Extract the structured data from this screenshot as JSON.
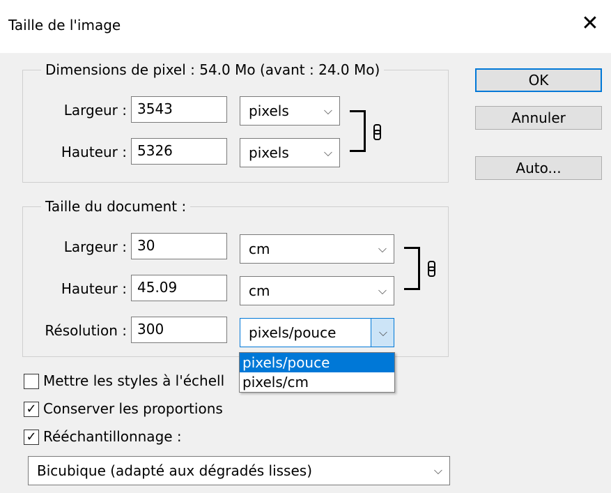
{
  "window": {
    "title": "Taille de l'image",
    "close_glyph": "✕"
  },
  "pixel_dimensions": {
    "legend": "Dimensions de pixel :  54.0 Mo (avant : 24.0 Mo)",
    "width_label": "Largeur :",
    "width_value": "3543",
    "width_unit": "pixels",
    "height_label": "Hauteur :",
    "height_value": "5326",
    "height_unit": "pixels"
  },
  "document_size": {
    "legend": "Taille du document :",
    "width_label": "Largeur :",
    "width_value": "30",
    "width_unit": "cm",
    "height_label": "Hauteur :",
    "height_value": "45.09",
    "height_unit": "cm",
    "resolution_label": "Résolution :",
    "resolution_value": "300",
    "resolution_unit": "pixels/pouce"
  },
  "resolution_dropdown": {
    "options": [
      "pixels/pouce",
      "pixels/cm"
    ],
    "highlighted": "pixels/pouce"
  },
  "buttons": {
    "ok": "OK",
    "cancel": "Annuler",
    "auto": "Auto..."
  },
  "options": {
    "scale_styles": {
      "label": "Mettre les styles à l'échell",
      "checked": false
    },
    "constrain": {
      "label": "Conserver les proportions",
      "checked": true
    },
    "resample": {
      "label": "Rééchantillonnage :",
      "checked": true
    }
  },
  "resample_method": "Bicubique (adapté aux dégradés lisses)",
  "glyphs": {
    "check": "✓",
    "chevron": "⌵"
  },
  "colors": {
    "accent": "#0078d7",
    "dialog_bg": "#f0f0f0",
    "highlight_light": "#cce4f7"
  }
}
